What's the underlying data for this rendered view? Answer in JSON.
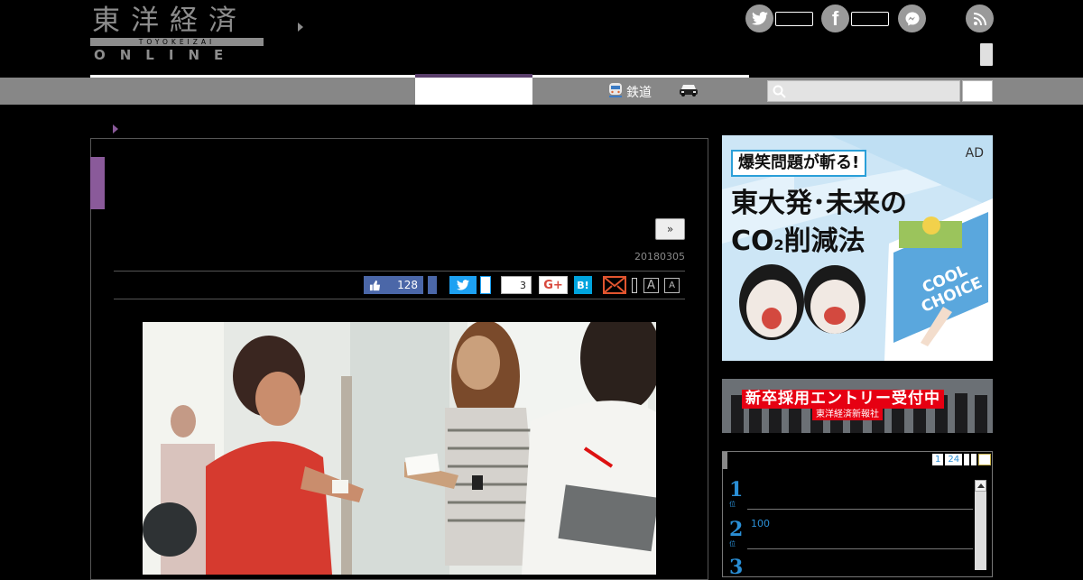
{
  "header": {
    "logo_kanji": "東洋経済",
    "logo_romaji": "TOYOKEIZAI",
    "logo_online": "ONLINE",
    "social_icons": [
      "twitter-icon",
      "facebook-icon",
      "messenger-icon",
      "rss-icon"
    ]
  },
  "nav": {
    "rail_label": "鉄道",
    "icons": [
      "train-icon",
      "car-icon",
      "search-icon"
    ]
  },
  "article": {
    "series_button": "»",
    "date": "20180305",
    "share": {
      "facebook_count": "128",
      "pocket_count": "3",
      "gplus_label": "G+",
      "hatena_label": "B!",
      "font_large": "A",
      "font_small": "A"
    }
  },
  "sidebar": {
    "ad1": {
      "badge": "AD",
      "tagline": "爆笑問題が斬る!",
      "headline_1": "東大発･未来の",
      "headline_2": "CO",
      "headline_2_sub": "2",
      "headline_2_rest": "削減法",
      "sign": "COOL CHOICE"
    },
    "ad2": {
      "headline": "新卒採用エントリー受付中",
      "company": "東洋経済新報社"
    },
    "ranking": {
      "tabs": [
        "1",
        "24"
      ],
      "rows": [
        {
          "rank": "1",
          "sub": "位",
          "text": ""
        },
        {
          "rank": "2",
          "sub": "位",
          "text": "100"
        },
        {
          "rank": "3",
          "sub": "",
          "text": ""
        }
      ]
    }
  },
  "colors": {
    "accent_purple": "#8a5a9a",
    "nav_gray": "#878787",
    "facebook": "#4b67a8",
    "twitter": "#1da1f2",
    "hatena": "#00a4de",
    "rank_blue": "#2a8fd6"
  }
}
